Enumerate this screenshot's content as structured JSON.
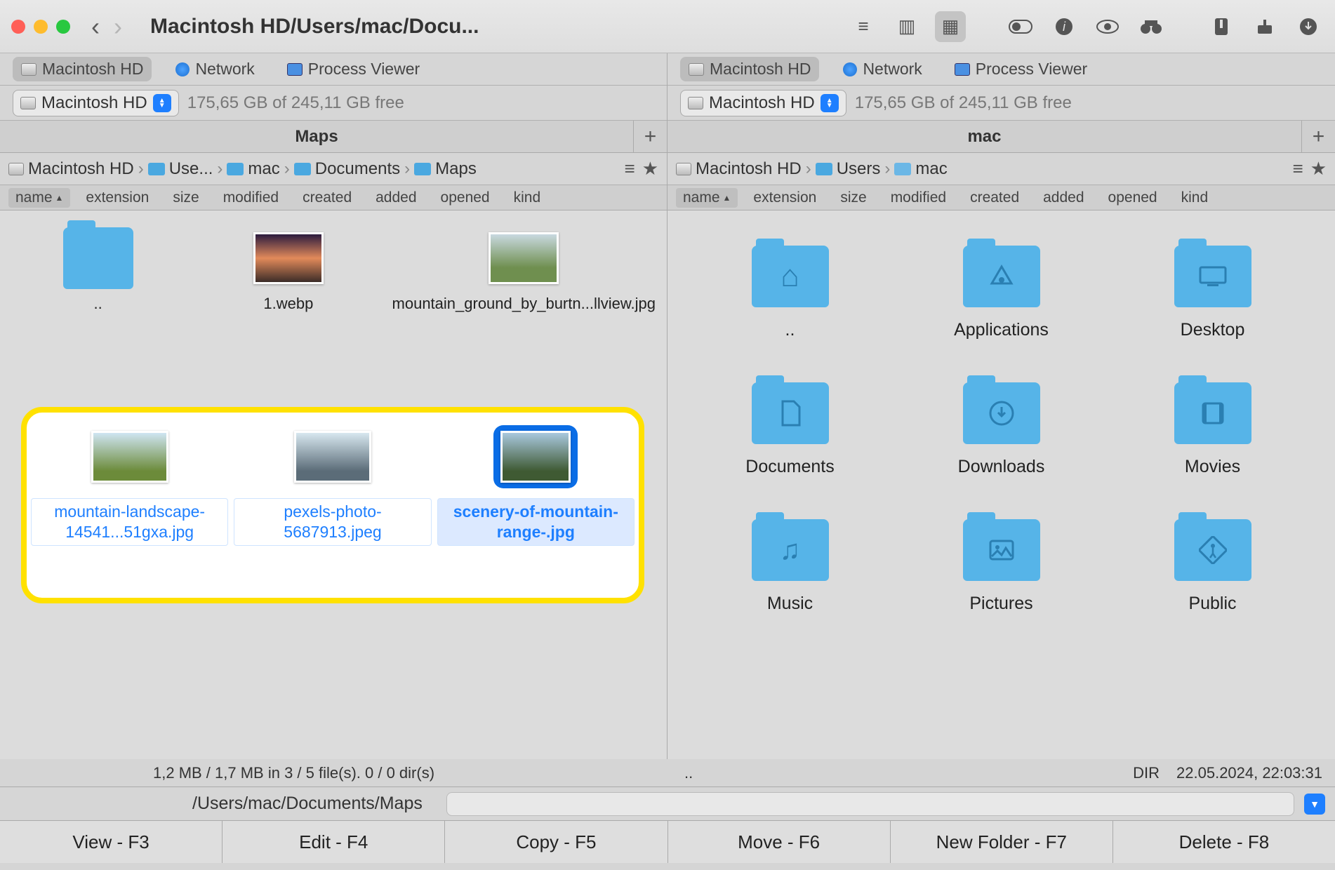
{
  "title": "Macintosh HD/Users/mac/Docu...",
  "toolbar_view_modes": [
    "list",
    "columns",
    "grid",
    "coverflow"
  ],
  "left": {
    "sources": [
      {
        "label": "Macintosh HD",
        "kind": "hd",
        "active": true
      },
      {
        "label": "Network",
        "kind": "net",
        "active": false
      },
      {
        "label": "Process Viewer",
        "kind": "mon",
        "active": false
      }
    ],
    "volume": "Macintosh HD",
    "free_text": "175,65 GB of 245,11 GB free",
    "tab": "Maps",
    "crumbs": [
      "Macintosh HD",
      "Use...",
      "mac",
      "Documents",
      "Maps"
    ],
    "columns": [
      "name",
      "extension",
      "size",
      "modified",
      "created",
      "added",
      "opened",
      "kind"
    ],
    "items": [
      {
        "name": "..",
        "kind": "folder"
      },
      {
        "name": "1.webp",
        "kind": "image"
      },
      {
        "name": "mountain_ground_by_burtn...llview.jpg",
        "kind": "image"
      }
    ],
    "highlighted": [
      {
        "name": "mountain-landscape-14541...51gxa.jpg",
        "selected": false
      },
      {
        "name": "pexels-photo-5687913.jpeg",
        "selected": false
      },
      {
        "name": "scenery-of-mountain-range-.jpg",
        "selected": true
      }
    ],
    "status": "1,2 MB / 1,7 MB in 3 / 5 file(s). 0 / 0 dir(s)"
  },
  "right": {
    "sources": [
      {
        "label": "Macintosh HD",
        "kind": "hd",
        "active": true
      },
      {
        "label": "Network",
        "kind": "net",
        "active": false
      },
      {
        "label": "Process Viewer",
        "kind": "mon",
        "active": false
      }
    ],
    "volume": "Macintosh HD",
    "free_text": "175,65 GB of 245,11 GB free",
    "tab": "mac",
    "crumbs": [
      "Macintosh HD",
      "Users",
      "mac"
    ],
    "columns": [
      "name",
      "extension",
      "size",
      "modified",
      "created",
      "added",
      "opened",
      "kind"
    ],
    "items": [
      {
        "name": "..",
        "glyph": ""
      },
      {
        "name": "Applications",
        "glyph": "A"
      },
      {
        "name": "Desktop",
        "glyph": "▭"
      },
      {
        "name": "Documents",
        "glyph": "📄"
      },
      {
        "name": "Downloads",
        "glyph": "↓"
      },
      {
        "name": "Movies",
        "glyph": "🎬"
      },
      {
        "name": "Music",
        "glyph": "♪"
      },
      {
        "name": "Pictures",
        "glyph": "▣"
      },
      {
        "name": "Public",
        "glyph": "⇪"
      }
    ],
    "items_glyphs": {
      "0": "⌂",
      "1": "�᠎",
      "2": "▭",
      "3": "🗎",
      "4": "⬇",
      "5": "▦",
      "6": "♫",
      "7": "▢",
      "8": "🚶"
    },
    "status_left": "..",
    "status_dir": "DIR",
    "status_date": "22.05.2024, 22:03:31"
  },
  "path": "/Users/mac/Documents/Maps",
  "fkeys": [
    {
      "label": "View - F3"
    },
    {
      "label": "Edit - F4"
    },
    {
      "label": "Copy - F5"
    },
    {
      "label": "Move - F6"
    },
    {
      "label": "New Folder - F7"
    },
    {
      "label": "Delete - F8"
    }
  ]
}
